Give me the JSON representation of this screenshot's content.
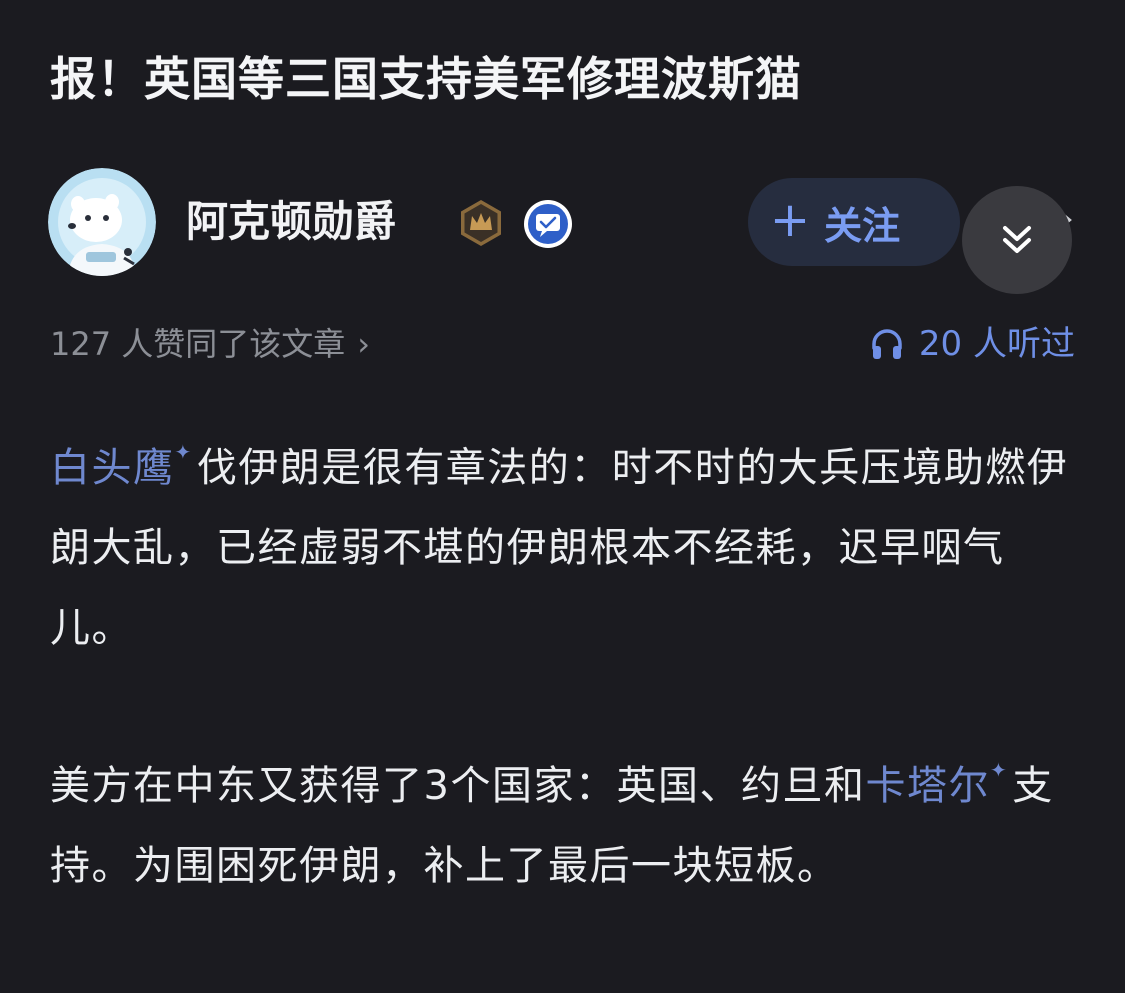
{
  "article": {
    "title": "报！英国等三国支持美军修理波斯猫"
  },
  "author": {
    "name": "阿克顿勋爵",
    "follow_plus": "+",
    "follow_label": "关注"
  },
  "stats": {
    "likes_text": "127 人赞同了该文章",
    "likes_arrow": "›",
    "listens_text": "20 人听过"
  },
  "body": {
    "p1_link": "白头鹰",
    "p1_rest": "伐伊朗是很有章法的：时不时的大兵压境助燃伊朗大乱，已经虚弱不堪的伊朗根本不经耗，迟早咽气儿。",
    "p2_start": "美方在中东又获得了3个国家：英国、约旦和",
    "p2_link": "卡塔尔",
    "p2_rest": "支持。为围困死伊朗，补上了最后一块短板。",
    "spark": "✦"
  },
  "colors": {
    "background": "#1b1b20",
    "link": "#6f88cf",
    "accent": "#7a9cf2",
    "muted": "#8c8f96"
  },
  "icons": {
    "avatar": "polar-bear-astronaut-avatar",
    "crown": "crown-badge-icon",
    "verified": "verified-badge-icon",
    "collapse": "double-chevron-down-icon",
    "headphones": "headphones-icon"
  }
}
